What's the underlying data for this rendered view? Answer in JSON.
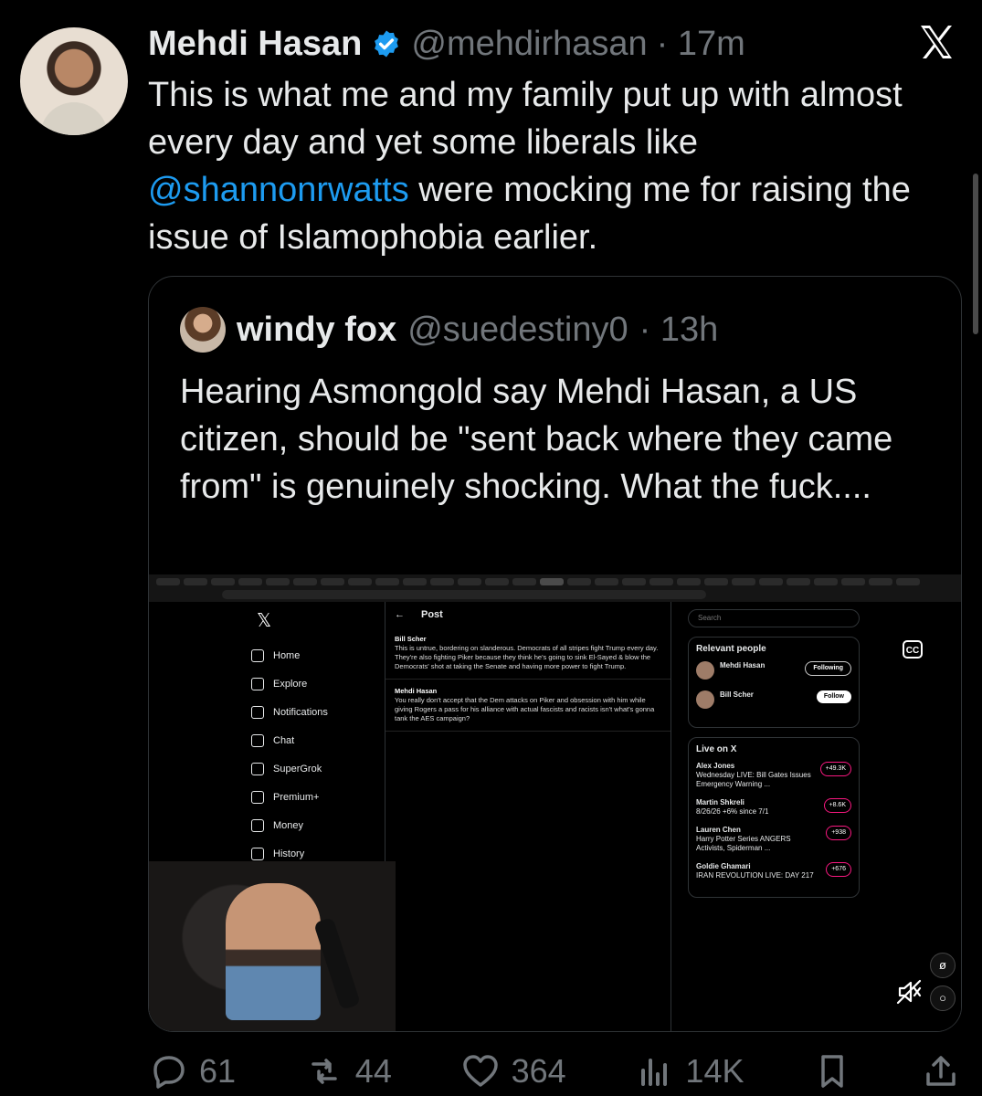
{
  "author": {
    "name": "Mehdi Hasan",
    "handle": "@mehdirhasan",
    "time": "· 17m"
  },
  "post": {
    "text_before": "This is what me and my family put up with almost every day and yet some liberals like",
    "mention": "@shannonrwatts",
    "text_after": "were mocking me for raising the issue of Islamophobia earlier."
  },
  "quote": {
    "name": "windy fox",
    "handle": "@suedestiny0",
    "time": "· 13h",
    "text": "Hearing Asmongold say Mehdi Hasan, a US citizen, should be \"sent back where they came from\" is genuinely shocking. What the fuck...."
  },
  "embedded_page": {
    "nav": [
      "Home",
      "Explore",
      "Notifications",
      "Chat",
      "SuperGrok",
      "Premium+",
      "Money",
      "History"
    ],
    "post_title": "Post",
    "search": "Search",
    "relevant_title": "Relevant people",
    "live_title": "Live on X",
    "tweets": [
      {
        "name": "Bill Scher",
        "text": "This is untrue, bordering on slanderous. Democrats of all stripes fight Trump every day. They're also fighting Piker because they think he's going to sink El-Sayed & blow the Democrats' shot at taking the Senate and having more power to fight Trump."
      },
      {
        "name": "Mehdi Hasan",
        "text": "You really don't accept that the Dem attacks on Piker and obsession with him while giving Rogers a pass for his alliance with actual fascists and racists isn't what's gonna tank the AES campaign?"
      }
    ],
    "people": [
      {
        "name": "Mehdi Hasan",
        "button": "Following"
      },
      {
        "name": "Bill Scher",
        "button": "Follow"
      }
    ],
    "live": [
      {
        "name": "Alex Jones",
        "title": "Wednesday LIVE: Bill Gates Issues Emergency Warning ...",
        "count": "+49.3K"
      },
      {
        "name": "Martin Shkreli",
        "title": "8/26/26 +6% since 7/1",
        "count": "+8.6K"
      },
      {
        "name": "Lauren Chen",
        "title": "Harry Potter Series ANGERS Activists, Spiderman ...",
        "count": "+938"
      },
      {
        "name": "Goldie Ghamari",
        "title": "IRAN REVOLUTION LIVE: DAY 217",
        "count": "+676"
      }
    ]
  },
  "actions": {
    "replies": "61",
    "reposts": "44",
    "likes": "364",
    "views": "14K"
  }
}
